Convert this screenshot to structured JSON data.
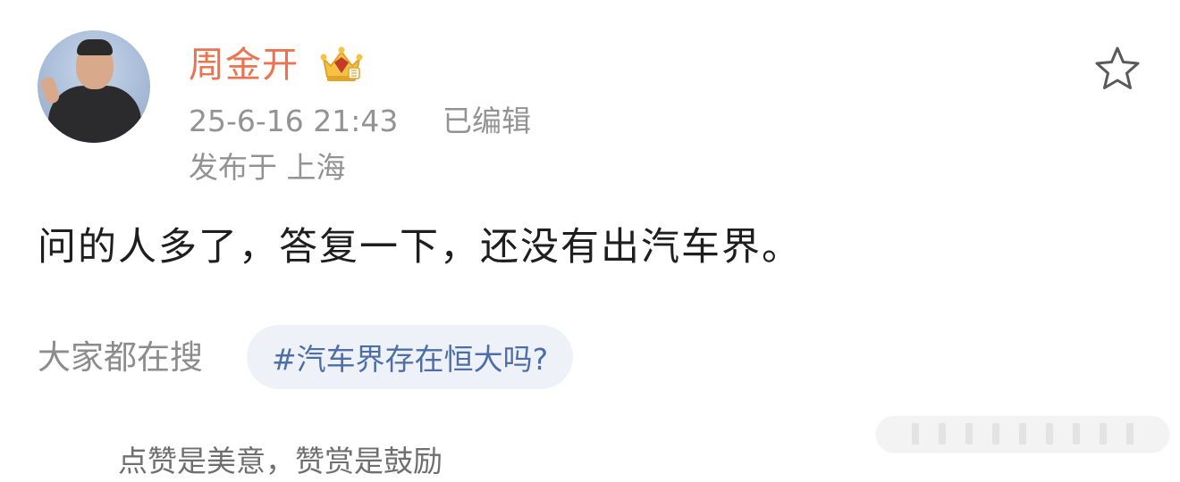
{
  "post": {
    "author_name": "周金开",
    "badge_icon": "crown-vip-icon",
    "time": "25-6-16 21:43",
    "edited": "已编辑",
    "location": "发布于 上海",
    "content": "问的人多了，答复一下，还没有出汽车界。"
  },
  "search": {
    "label": "大家都在搜",
    "tag": "#汽车界存在恒大吗?"
  },
  "footer": {
    "text": "点赞是美意，赞赏是鼓励"
  },
  "colors": {
    "name": "#eb7350",
    "meta": "#939393",
    "tag_bg": "#eef1f7",
    "tag_text": "#4e6ea8"
  }
}
